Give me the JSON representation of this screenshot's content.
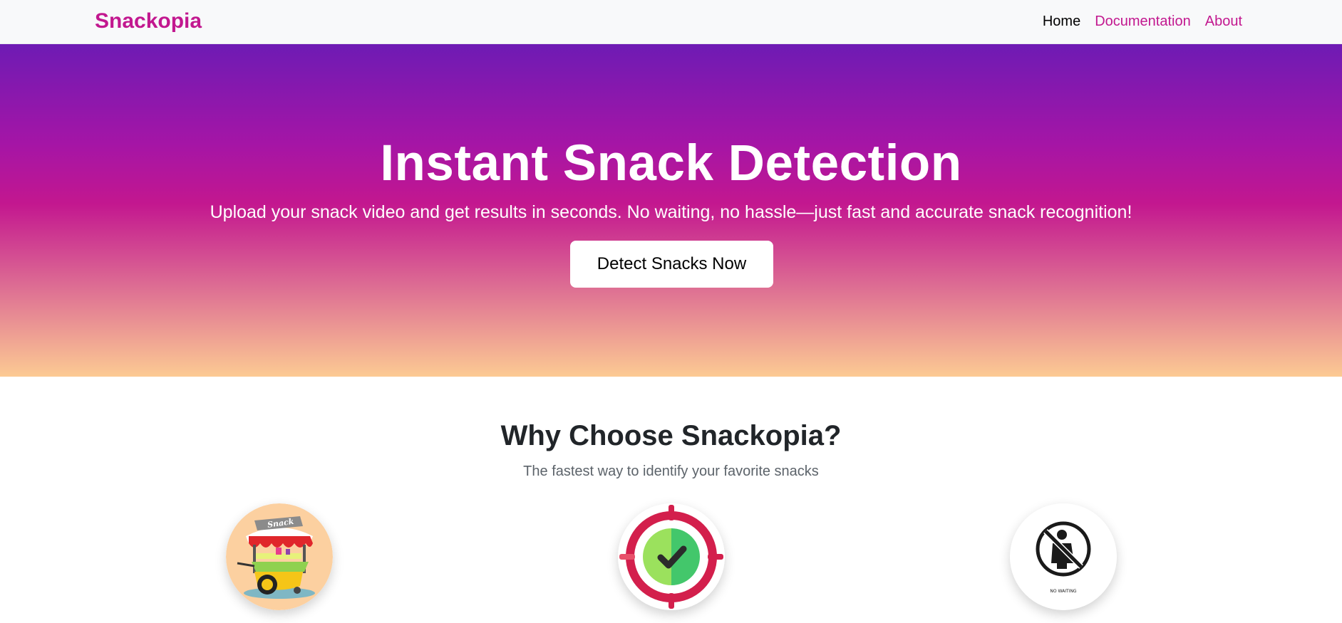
{
  "nav": {
    "brand": "Snackopia",
    "links": [
      {
        "label": "Home",
        "active": true
      },
      {
        "label": "Documentation",
        "active": false
      },
      {
        "label": "About",
        "active": false
      }
    ]
  },
  "hero": {
    "title": "Instant Snack Detection",
    "subtitle": "Upload your snack video and get results in seconds. No waiting, no hassle—just fast and accurate snack recognition!",
    "cta_label": "Detect Snacks Now"
  },
  "features": {
    "title": "Why Choose Snackopia?",
    "subtitle": "The fastest way to identify your favorite snacks",
    "icons": [
      {
        "name": "snack-cart-icon",
        "label": "Snack"
      },
      {
        "name": "target-check-icon"
      },
      {
        "name": "no-waiting-icon",
        "label": "NO WAITING"
      }
    ]
  },
  "colors": {
    "brand": "#c2188f",
    "hero_gradient": [
      "#6e1bb4",
      "#c3178f",
      "#fcca93"
    ]
  }
}
